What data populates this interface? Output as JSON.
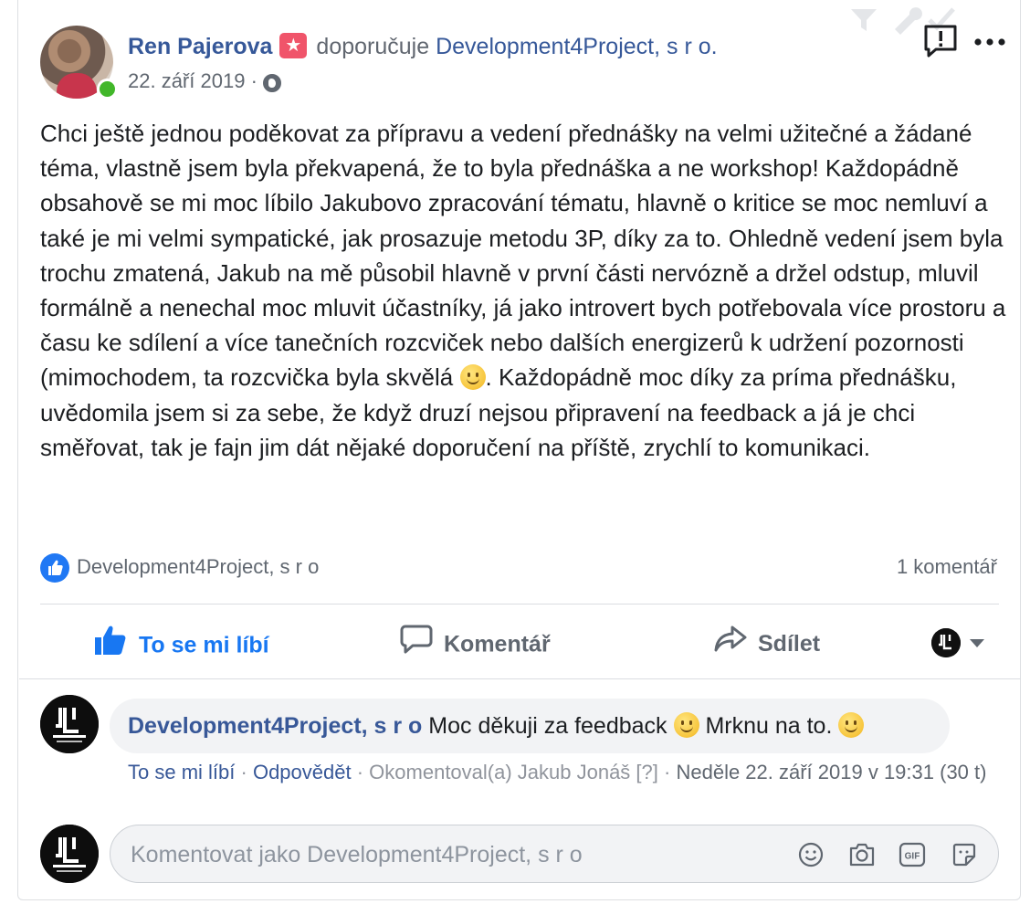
{
  "post": {
    "author": "Ren Pajerova",
    "action": "doporučuje",
    "page": "Development4Project, s r o.",
    "date": "22. září 2019",
    "date_separator": "·",
    "text_before_emoji": "Chci ještě jednou poděkovat za přípravu a vedení přednášky na velmi užitečné a žádané téma, vlastně jsem byla překvapená, že to byla přednáška a ne workshop! Každopádně obsahově se mi moc líbilo Jakubovo zpracování tématu, hlavně o kritice se moc nemluví a také je mi velmi sympatické, jak prosazuje metodu 3P, díky za to. Ohledně vedení jsem byla trochu zmatená, Jakub na mě působil hlavně v první části nervózně a držel odstup, mluvil formálně a nenechal moc mluvit účastníky, já jako introvert bych potřebovala více prostoru a času ke sdílení a více tanečních rozcviček nebo dalších energizerů k udržení pozornosti (mimochodem, ta rozcvička byla skvělá",
    "text_after_emoji": ". Každopádně moc díky za príma přednášku, uvědomila jsem si za sebe, že když druzí nejsou připravení na feedback a já je chci směřovat, tak je fajn jim dát nějaké doporučení na příště, zrychlí to komunikaci."
  },
  "stats": {
    "liked_by": "Development4Project, s r o",
    "comment_count": "1 komentář"
  },
  "actions": {
    "like": "To se mi líbí",
    "comment": "Komentář",
    "share": "Sdílet"
  },
  "comment": {
    "author": "Development4Project, s r o",
    "text_part1": "Moc děkuji za feedback",
    "text_part2": "Mrknu na to.",
    "like_link": "To se mi líbí",
    "reply_link": "Odpovědět",
    "sep": "·",
    "commented_by": "Okomentoval(a) Jakub Jonáš [?]",
    "timestamp": "Neděle 22. září 2019 v 19:31 (30 t)"
  },
  "composer": {
    "placeholder": "Komentovat jako Development4Project, s r o"
  },
  "colors": {
    "link": "#365899",
    "like_blue": "#1877f2",
    "online": "#42b72a"
  },
  "icons": [
    "filter-icon",
    "wrench-icon",
    "check-icon",
    "report-icon",
    "more-icon",
    "globe-icon",
    "like-icon",
    "comment-icon",
    "share-icon",
    "emoji-icon",
    "camera-icon",
    "gif-icon",
    "sticker-icon"
  ]
}
